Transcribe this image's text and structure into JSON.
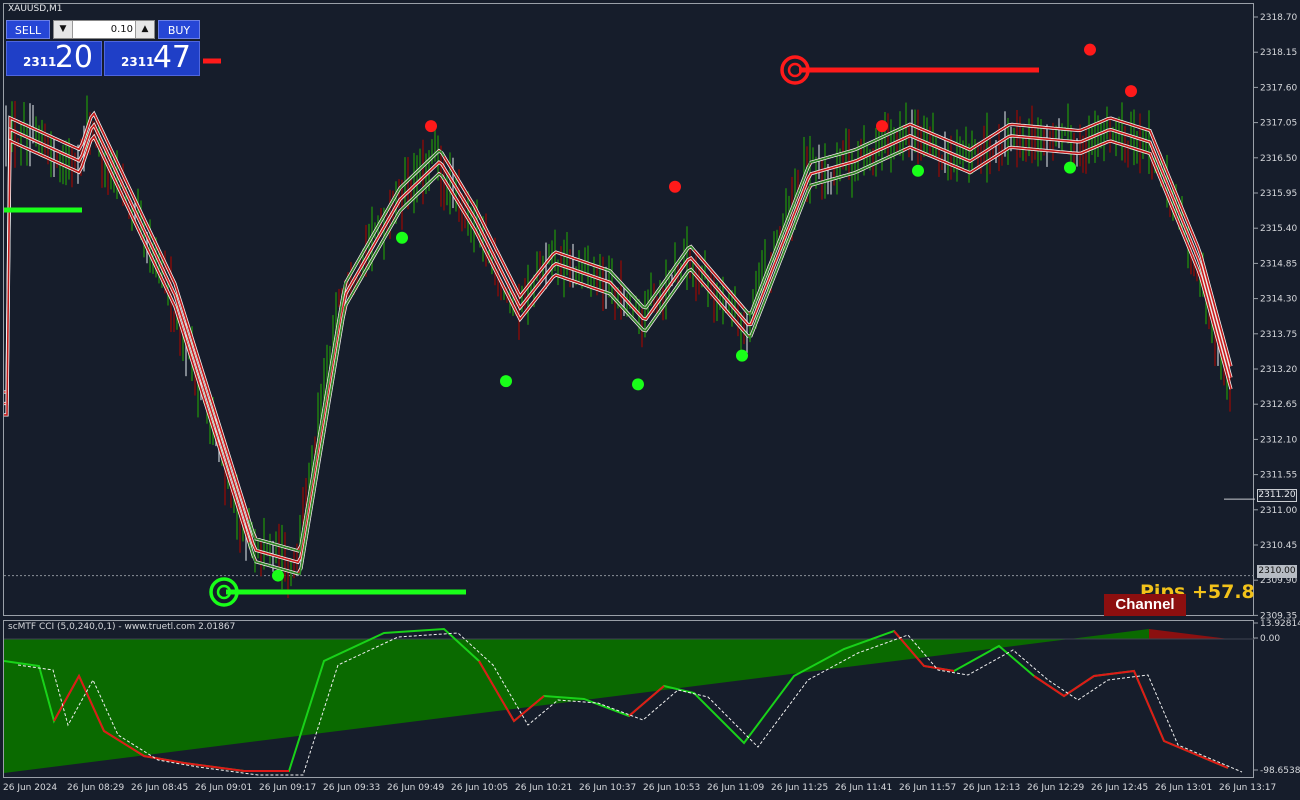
{
  "window": {
    "symbol_title": "XAUUSD,M1"
  },
  "trade_panel": {
    "sell_label": "SELL",
    "buy_label": "BUY",
    "lot_value": "0.10",
    "sell_price_prefix": "2311",
    "sell_price_big": "20",
    "buy_price_prefix": "2311",
    "buy_price_big": "47"
  },
  "price_axis": {
    "ticks": [
      "2318.70",
      "2318.15",
      "2317.60",
      "2317.05",
      "2316.50",
      "2315.95",
      "2315.40",
      "2314.85",
      "2314.30",
      "2313.75",
      "2313.20",
      "2312.65",
      "2312.10",
      "2311.55",
      "2311.00",
      "2310.45",
      "2309.90",
      "2309.35"
    ],
    "current_price_label": "2311.20",
    "level_label": "2310.00"
  },
  "indicator": {
    "title": "scMTF CCI (5,0,240,0,1) - www.truetl.com 2.01867",
    "axis_max": "13.92814",
    "axis_zero": "0.00",
    "axis_min": "-98.6538"
  },
  "overlay": {
    "pips_label": "Pips +57.8",
    "channel_label": "Channel"
  },
  "time_axis": [
    "26 Jun 2024",
    "26 Jun 08:29",
    "26 Jun 08:45",
    "26 Jun 09:01",
    "26 Jun 09:17",
    "26 Jun 09:33",
    "26 Jun 09:49",
    "26 Jun 10:05",
    "26 Jun 10:21",
    "26 Jun 10:37",
    "26 Jun 10:53",
    "26 Jun 11:09",
    "26 Jun 11:25",
    "26 Jun 11:41",
    "26 Jun 11:57",
    "26 Jun 12:13",
    "26 Jun 12:29",
    "26 Jun 12:45",
    "26 Jun 13:01",
    "26 Jun 13:17"
  ],
  "colors": {
    "background": "#161d2b",
    "bull": "#1f7a12",
    "bear": "#7a0d0d",
    "neutral": "#9aa0a8",
    "signal_buy": "#19ff19",
    "signal_sell": "#ff1a1a",
    "pips": "#f2c21a"
  },
  "chart_data": {
    "type": "line",
    "x_range_time": [
      "26 Jun 2024",
      "26 Jun 13:17"
    ],
    "price_ylim": [
      2309.35,
      2318.7
    ],
    "price_path": [
      [
        0,
        2317.0
      ],
      [
        70,
        2316.5
      ],
      [
        83,
        2317.1
      ],
      [
        165,
        2314.4
      ],
      [
        245,
        2310.4
      ],
      [
        290,
        2310.2
      ],
      [
        335,
        2314.4
      ],
      [
        390,
        2315.9
      ],
      [
        430,
        2316.5
      ],
      [
        465,
        2315.6
      ],
      [
        510,
        2314.2
      ],
      [
        545,
        2314.9
      ],
      [
        600,
        2314.6
      ],
      [
        635,
        2314.0
      ],
      [
        680,
        2315.0
      ],
      [
        740,
        2313.9
      ],
      [
        800,
        2316.3
      ],
      [
        845,
        2316.5
      ],
      [
        900,
        2316.9
      ],
      [
        960,
        2316.5
      ],
      [
        1000,
        2316.9
      ],
      [
        1070,
        2316.8
      ],
      [
        1100,
        2317.0
      ],
      [
        1140,
        2316.8
      ],
      [
        1190,
        2314.9
      ],
      [
        1228,
        2312.7
      ]
    ],
    "sell_signals_price": [
      2317.05,
      2316.1,
      2317.05,
      2318.25,
      2317.6
    ],
    "buy_signals_price": [
      2310.0,
      2315.3,
      2313.05,
      2313.0,
      2313.45,
      2316.35,
      2316.4
    ],
    "levels": {
      "support": 2310.0,
      "resistance": 2317.9,
      "current": 2311.2
    },
    "cci_ylim": [
      -98.6538,
      13.92814
    ]
  }
}
